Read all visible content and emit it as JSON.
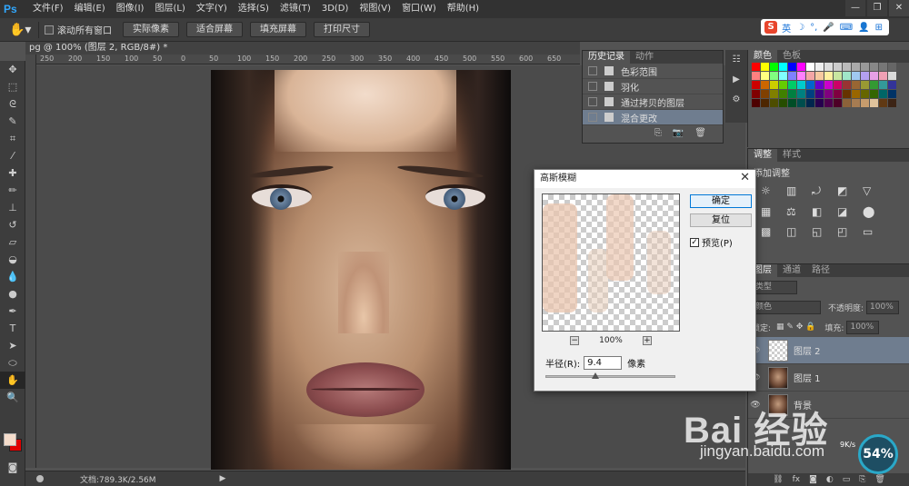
{
  "app": {
    "logo": "Ps",
    "menus": [
      "文件(F)",
      "编辑(E)",
      "图像(I)",
      "图层(L)",
      "文字(Y)",
      "选择(S)",
      "滤镜(T)",
      "3D(D)",
      "视图(V)",
      "窗口(W)",
      "帮助(H)"
    ]
  },
  "options": {
    "scroll_all_label": "滚动所有窗口",
    "buttons": [
      "实际像素",
      "适合屏幕",
      "填充屏幕",
      "打印尺寸"
    ]
  },
  "ime": {
    "brand": "S",
    "lang": "英"
  },
  "document": {
    "tab_title": "pg @ 100% (图层 2, RGB/8#) *",
    "ruler_ticks": [
      "250",
      "200",
      "150",
      "100",
      "50",
      "0",
      "50",
      "100",
      "150",
      "200",
      "250",
      "300",
      "350",
      "400",
      "450",
      "500",
      "550",
      "600",
      "650"
    ],
    "status": "文档:789.3K/2.56M"
  },
  "history": {
    "tabs": [
      "历史记录",
      "动作"
    ],
    "items": [
      "色彩范围",
      "羽化",
      "通过拷贝的图层",
      "混合更改"
    ],
    "selected_index": 3
  },
  "swatches": {
    "tabs": [
      "颜色",
      "色板"
    ],
    "colors": [
      "#ff0000",
      "#ffff00",
      "#00ff00",
      "#00ffff",
      "#0000ff",
      "#ff00ff",
      "#ffffff",
      "#eeeeee",
      "#dddddd",
      "#cccccc",
      "#bbbbbb",
      "#aaaaaa",
      "#999999",
      "#888888",
      "#777777",
      "#666666",
      "#ff8080",
      "#ffff80",
      "#80ff80",
      "#80ffff",
      "#8080ff",
      "#ff80ff",
      "#f4a6a6",
      "#f7c9a0",
      "#fff0a0",
      "#c8e6a0",
      "#a0e6c8",
      "#a0c8f0",
      "#b4a0f0",
      "#e6a0e6",
      "#f0a0b4",
      "#d9d9d9",
      "#cc0000",
      "#cc6600",
      "#cccc00",
      "#66cc00",
      "#00cc66",
      "#00cccc",
      "#0066cc",
      "#6600cc",
      "#cc00cc",
      "#cc0066",
      "#993333",
      "#996633",
      "#999933",
      "#339933",
      "#339999",
      "#333399",
      "#800000",
      "#804000",
      "#808000",
      "#408000",
      "#008040",
      "#008080",
      "#004080",
      "#400080",
      "#800080",
      "#800040",
      "#663300",
      "#996600",
      "#666600",
      "#336600",
      "#006666",
      "#003366",
      "#4d0000",
      "#4d2600",
      "#4d4d00",
      "#264d00",
      "#004d26",
      "#004d4d",
      "#00264d",
      "#26004d",
      "#4d004d",
      "#4d0026",
      "#8c6239",
      "#a67c52",
      "#c69c6d",
      "#e0c39c",
      "#603913",
      "#3c2415"
    ]
  },
  "adjustments": {
    "tabs": [
      "调整",
      "样式"
    ],
    "title": "添加调整"
  },
  "layers": {
    "tabs": [
      "图层",
      "通道",
      "路径"
    ],
    "kind_label": "类型",
    "blend_mode": "颜色",
    "opacity_label": "不透明度:",
    "opacity": "100%",
    "lock_label": "锁定:",
    "fill_label": "填充:",
    "fill": "100%",
    "items": [
      {
        "name": "图层 2",
        "selected": true,
        "thumb": "checker"
      },
      {
        "name": "图层 1",
        "selected": false,
        "thumb": "face"
      },
      {
        "name": "背景",
        "selected": false,
        "thumb": "face"
      }
    ]
  },
  "dialog": {
    "title": "高斯模糊",
    "ok": "确定",
    "reset": "复位",
    "preview_label": "预览(P)",
    "preview_checked": true,
    "zoom": "100%",
    "radius_label": "半径(R):",
    "radius_value": "9.4",
    "radius_unit": "像素"
  },
  "watermark": {
    "brand": "Bai 经验",
    "url": "jingyan.baidu.com",
    "net_percent": "54%",
    "net_speed": "9K/s"
  }
}
